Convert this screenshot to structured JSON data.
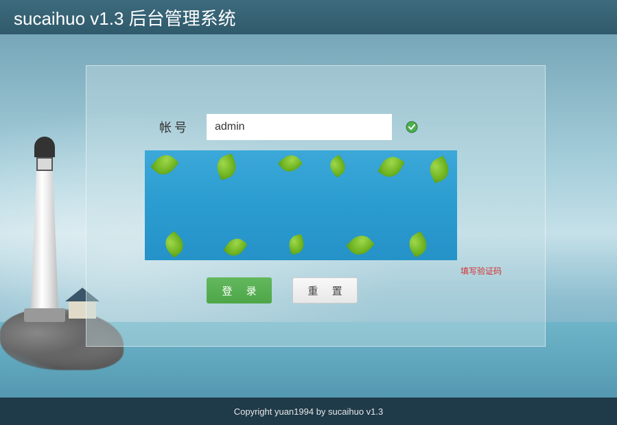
{
  "header": {
    "title": "sucaihuo v1.3 后台管理系统"
  },
  "form": {
    "username_label": "帐号",
    "username_value": "admin",
    "captcha_error": "填写验证码"
  },
  "buttons": {
    "login": "登 录",
    "reset": "重 置"
  },
  "footer": {
    "copyright": "Copyright yuan1994 by sucaihuo v1.3"
  }
}
